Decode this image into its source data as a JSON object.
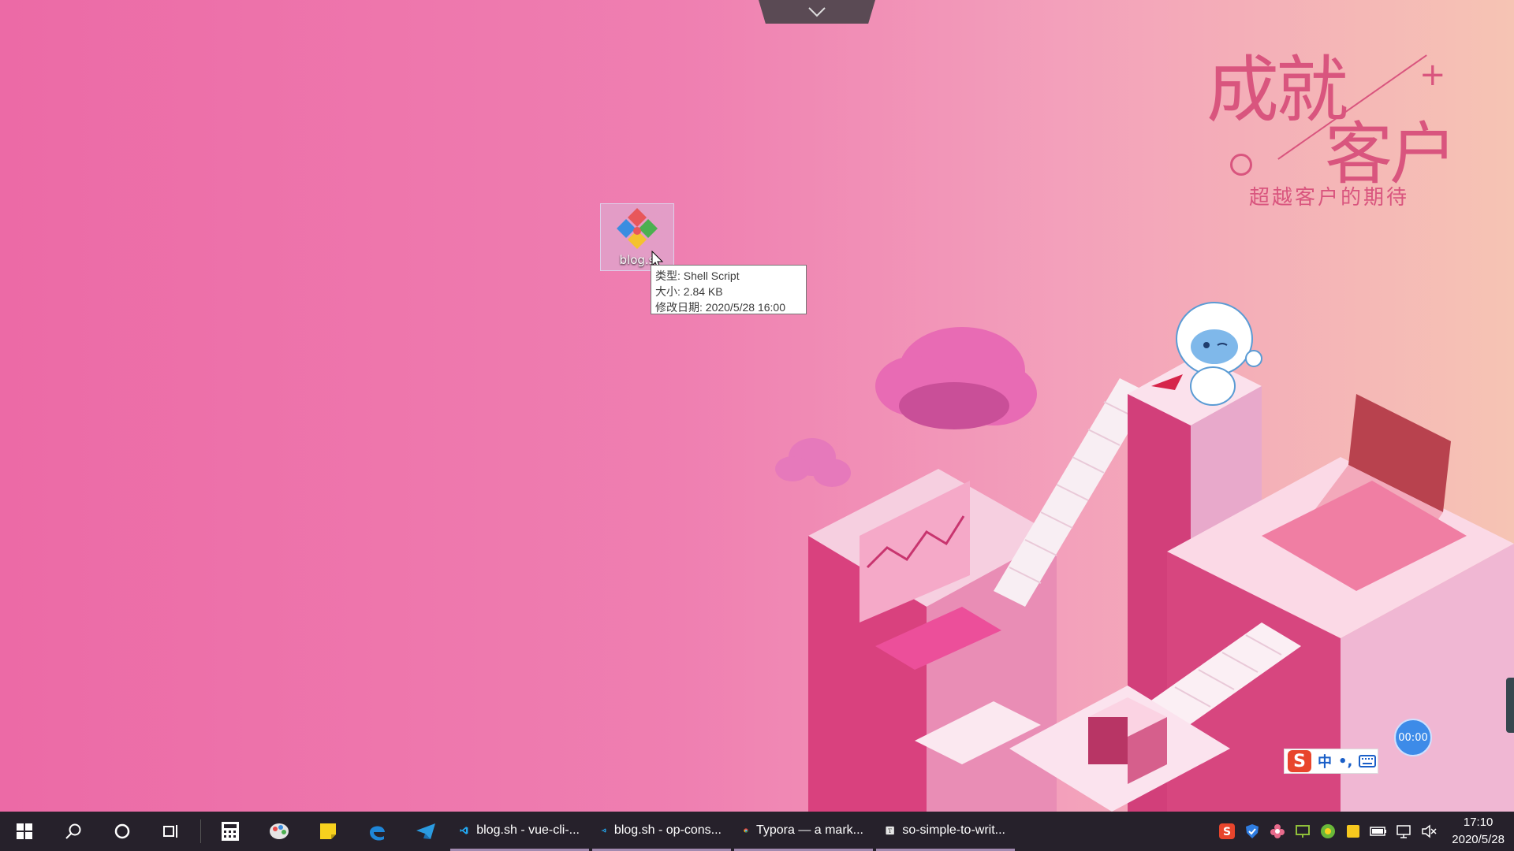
{
  "desktop": {
    "icon_label": "blog.s",
    "tooltip": {
      "type_line": "类型: Shell Script",
      "size_line": "大小: 2.84 KB",
      "modified_line": "修改日期: 2020/5/28 16:00"
    }
  },
  "wallpaper": {
    "slogan_line1": "成就",
    "slogan_line2": "客户",
    "slogan_sub": "超越客户的期待"
  },
  "overlays": {
    "timer": "00:00",
    "ime_mode": "中"
  },
  "taskbar": {
    "apps": [
      {
        "label": "blog.sh - vue-cli-...",
        "icon": "vscode-icon"
      },
      {
        "label": "blog.sh - op-cons...",
        "icon": "vscode-icon"
      },
      {
        "label": "Typora — a mark...",
        "icon": "chrome-icon"
      },
      {
        "label": "so-simple-to-writ...",
        "icon": "typora-icon"
      }
    ],
    "time": "17:10",
    "date": "2020/5/28"
  },
  "colors": {
    "taskbar_bg": "#26212b",
    "accent_underline": "#a28ab0",
    "slogan": "#d9557e"
  }
}
